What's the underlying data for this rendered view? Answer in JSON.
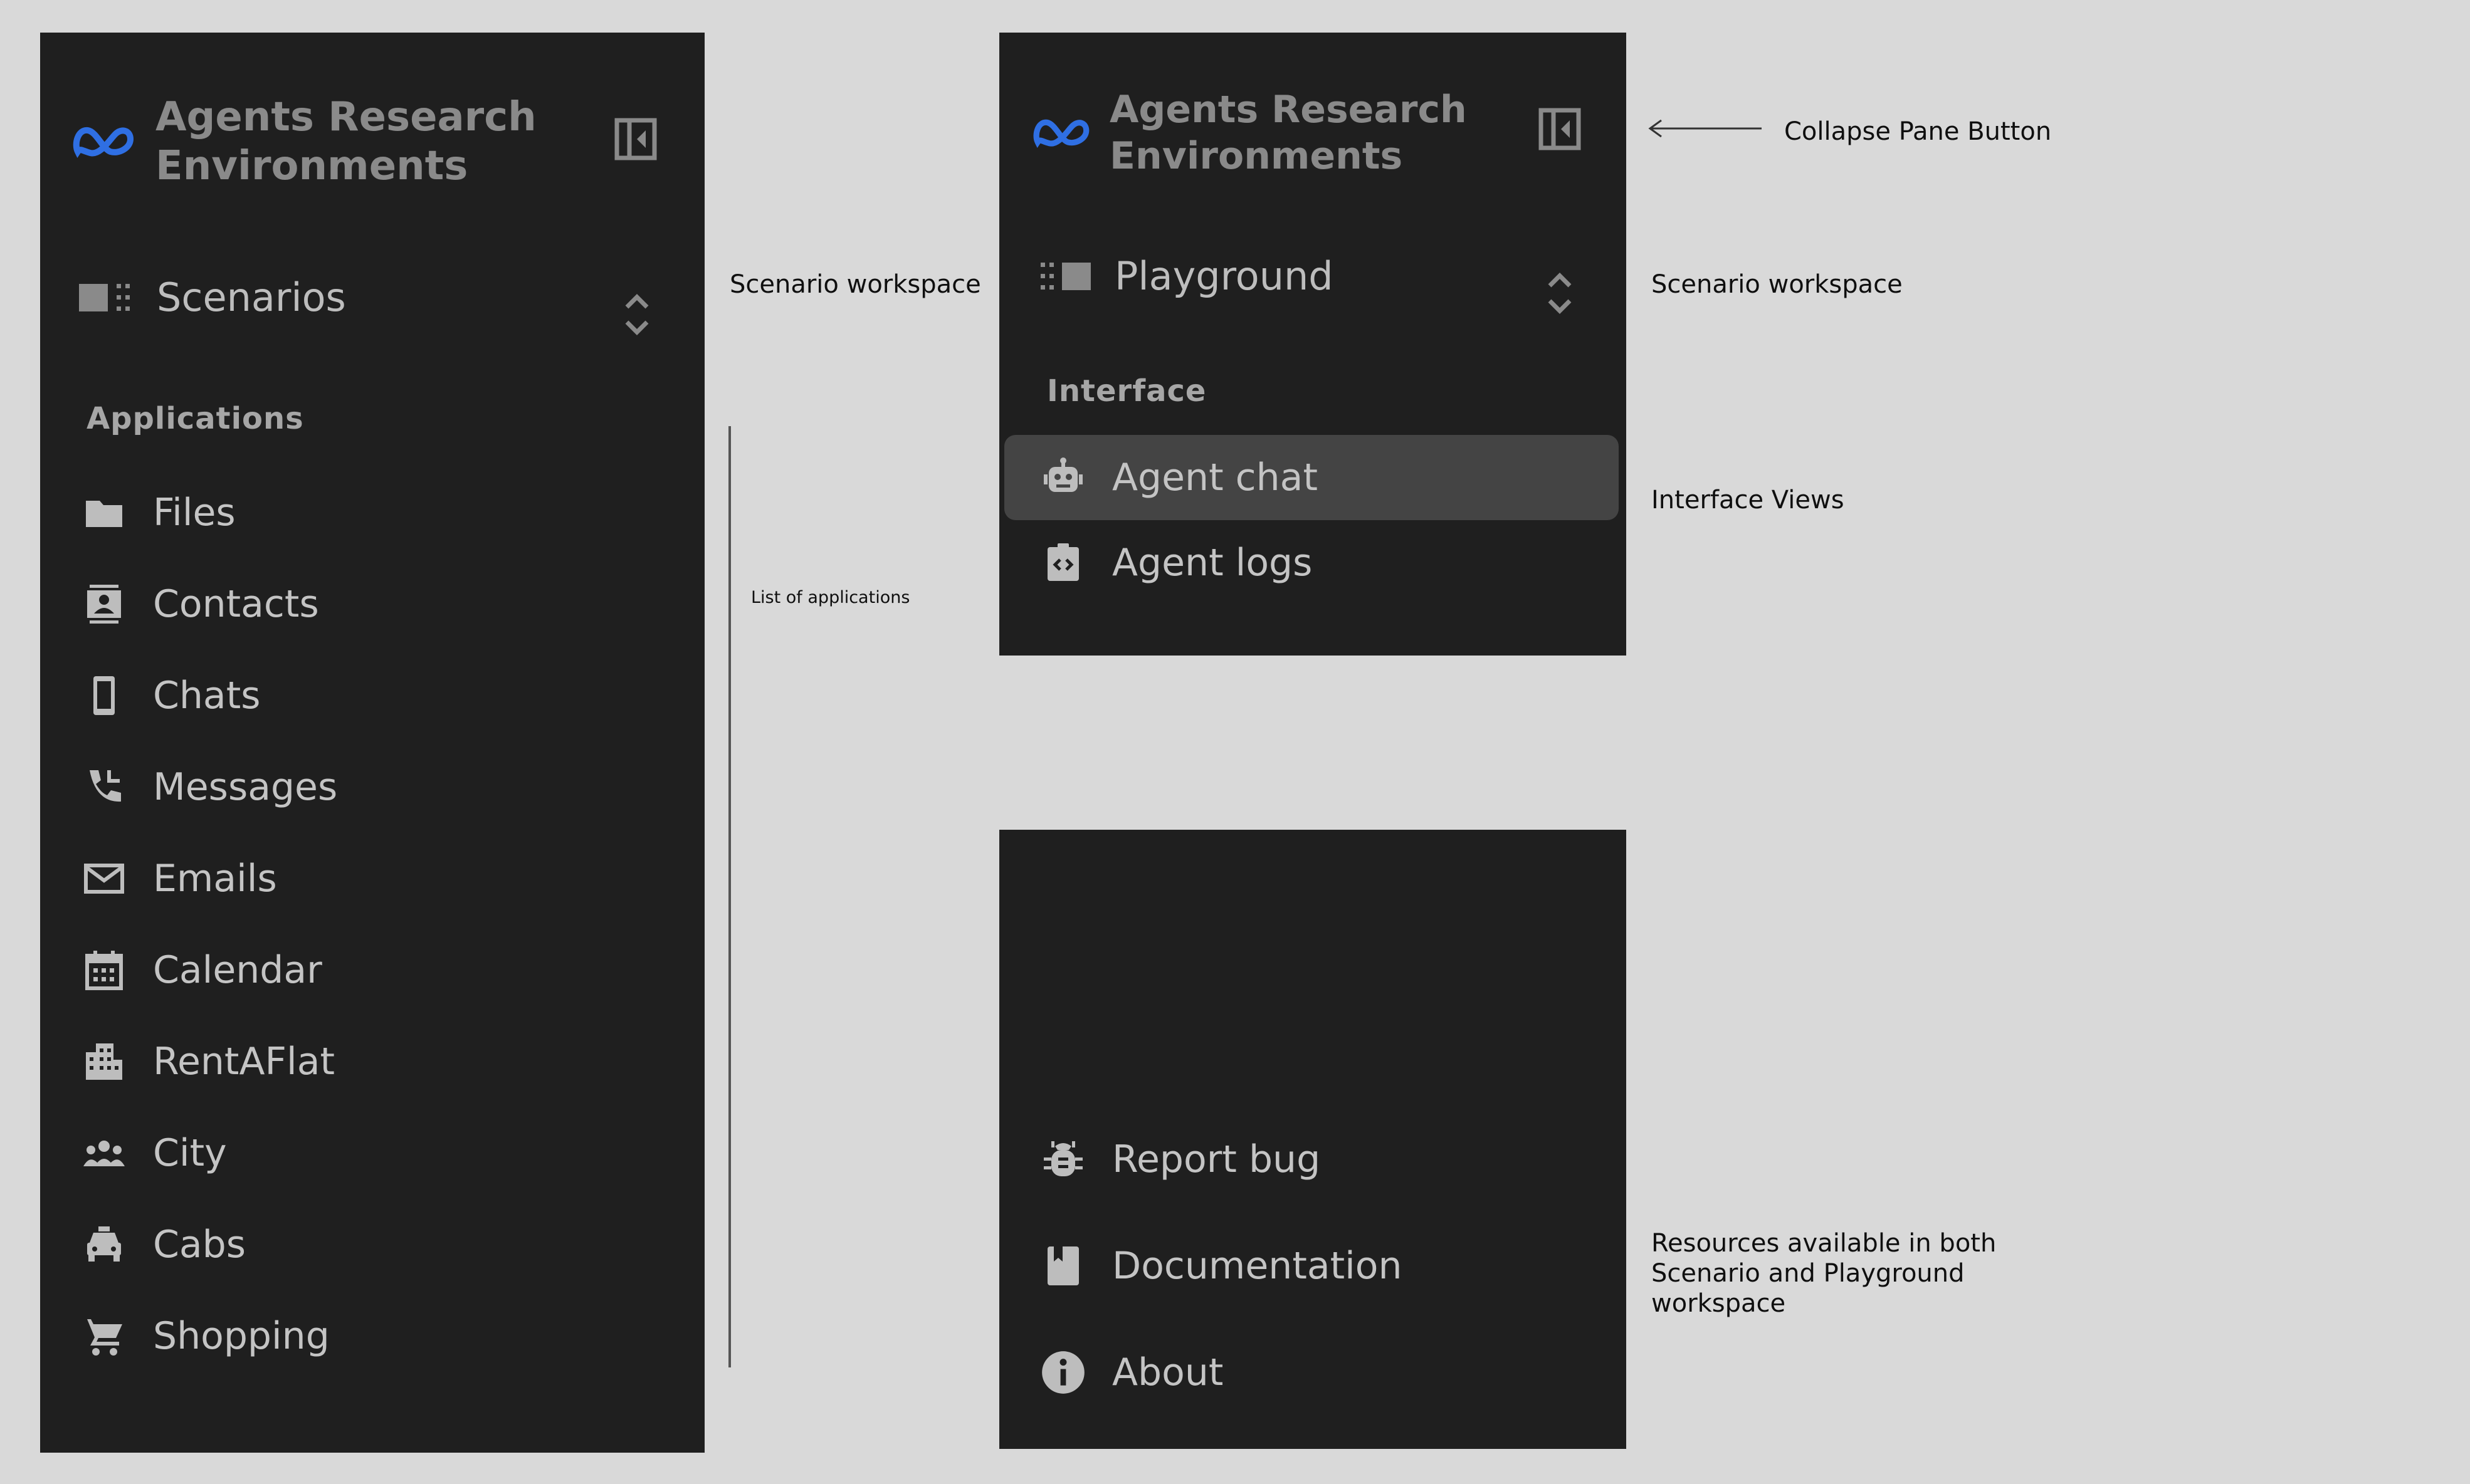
{
  "brand": {
    "title": "Agents Research\nEnvironments",
    "logo_icon": "meta-logo-icon",
    "logo_color": "#2f6fe3"
  },
  "left_panel": {
    "workspace_label": "Scenarios",
    "section_title": "Applications",
    "apps": [
      {
        "label": "Files",
        "icon": "folder-icon"
      },
      {
        "label": "Contacts",
        "icon": "contact-card-icon"
      },
      {
        "label": "Chats",
        "icon": "phone-icon"
      },
      {
        "label": "Messages",
        "icon": "phone-call-icon"
      },
      {
        "label": "Emails",
        "icon": "mail-icon"
      },
      {
        "label": "Calendar",
        "icon": "calendar-icon"
      },
      {
        "label": "RentAFlat",
        "icon": "building-icon"
      },
      {
        "label": "City",
        "icon": "people-icon"
      },
      {
        "label": "Cabs",
        "icon": "taxi-icon"
      },
      {
        "label": "Shopping",
        "icon": "cart-icon"
      }
    ]
  },
  "top_panel": {
    "workspace_label": "Playground",
    "section_title": "Interface",
    "views": [
      {
        "label": "Agent chat",
        "icon": "robot-icon",
        "active": true
      },
      {
        "label": "Agent logs",
        "icon": "code-clipboard-icon",
        "active": false
      }
    ]
  },
  "bottom_panel": {
    "resources": [
      {
        "label": "Report bug",
        "icon": "bug-icon"
      },
      {
        "label": "Documentation",
        "icon": "book-icon"
      },
      {
        "label": "About",
        "icon": "info-icon"
      }
    ]
  },
  "annotations": {
    "scenario_workspace_left": "Scenario workspace",
    "list_of_applications": "List of applications",
    "collapse_pane_button": "Collapse Pane Button",
    "scenario_workspace_right": "Scenario workspace",
    "interface_views": "Interface Views",
    "resources": "Resources available in both\nScenario and Playground\nworkspace"
  },
  "colors": {
    "canvas": "#d9d9d9",
    "panel": "#1f1f1f",
    "active_item": "#444444",
    "text": "#c4c4c4"
  }
}
